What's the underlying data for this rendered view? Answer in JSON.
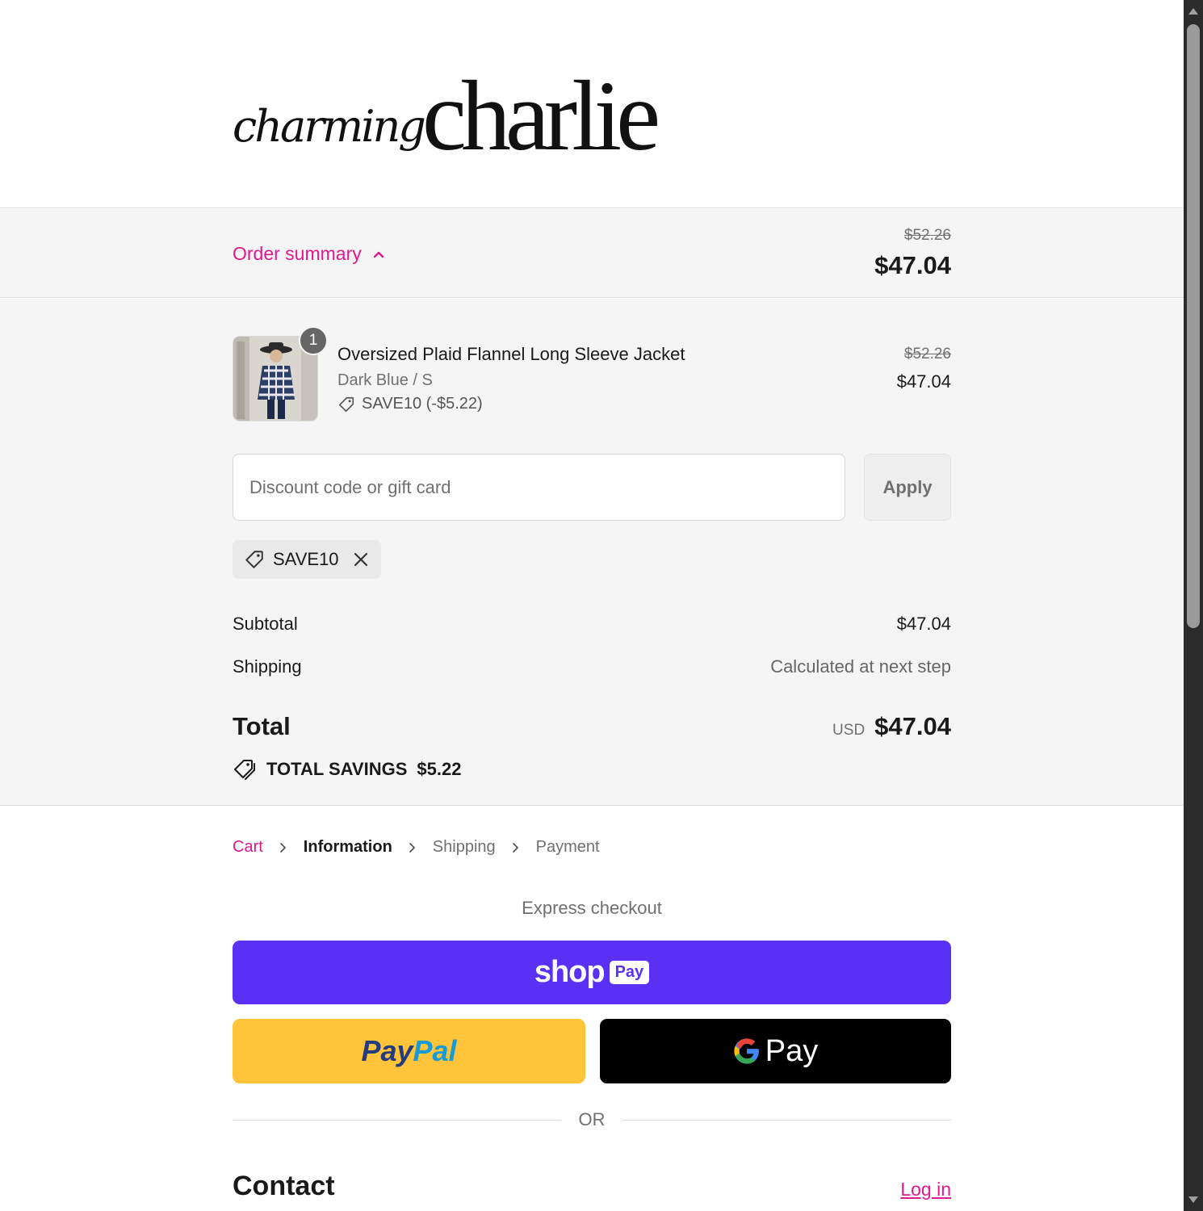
{
  "brand": {
    "logo_small": "charming",
    "logo_big": "charlie"
  },
  "summary_bar": {
    "toggle_label": "Order summary",
    "original_price": "$52.26",
    "price": "$47.04"
  },
  "item": {
    "quantity": "1",
    "name": "Oversized Plaid Flannel Long Sleeve Jacket",
    "variant": "Dark Blue / S",
    "discount": "SAVE10 (-$5.22)",
    "original_price": "$52.26",
    "price": "$47.04"
  },
  "discount": {
    "placeholder": "Discount code or gift card",
    "apply_label": "Apply",
    "applied_code": "SAVE10"
  },
  "totals": {
    "subtotal_label": "Subtotal",
    "subtotal_value": "$47.04",
    "shipping_label": "Shipping",
    "shipping_value": "Calculated at next step",
    "total_label": "Total",
    "currency": "USD",
    "total_value": "$47.04",
    "savings_label": "TOTAL SAVINGS",
    "savings_value": "$5.22"
  },
  "breadcrumb": {
    "cart": "Cart",
    "information": "Information",
    "shipping": "Shipping",
    "payment": "Payment"
  },
  "express": {
    "title": "Express checkout",
    "shop_word": "shop",
    "shop_pay": "Pay",
    "paypal_1": "Pay",
    "paypal_2": "Pal",
    "gpay_label": "Pay",
    "or": "OR"
  },
  "contact": {
    "heading": "Contact",
    "login": "Log in"
  },
  "colors": {
    "accent": "#e0198d",
    "shop_pay": "#5a31f4",
    "paypal": "#ffc439",
    "gpay": "#000000"
  },
  "icons": [
    "chevron-up-icon",
    "tag-icon",
    "close-icon",
    "savings-tags-icon",
    "chevron-right-icon",
    "google-g-icon"
  ]
}
